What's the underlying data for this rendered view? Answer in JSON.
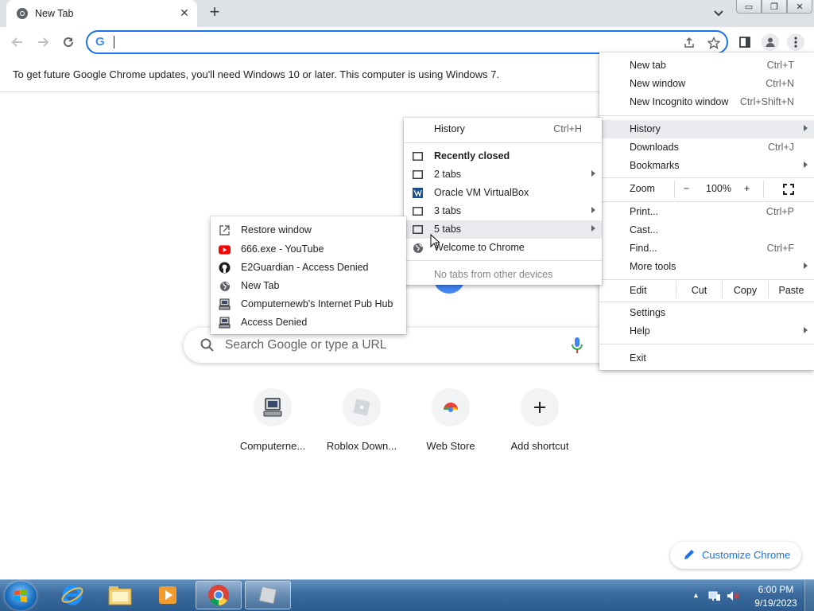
{
  "tab": {
    "title": "New Tab",
    "close": "✕"
  },
  "new_tab_button": "+",
  "window_controls": {
    "minimize": "▭",
    "restore": "❐",
    "close": "✕"
  },
  "toolbar": {
    "omnibox_value": "",
    "omnibox_g": "G"
  },
  "infobar": {
    "message": "To get future Google Chrome updates, you'll need Windows 10 or later. This computer is using Windows 7."
  },
  "ntp": {
    "search_placeholder": "Search Google or type a URL",
    "shortcuts": [
      {
        "label": "Computerne...",
        "icon": "computer-icon"
      },
      {
        "label": "Roblox Down...",
        "icon": "roblox-icon"
      },
      {
        "label": "Web Store",
        "icon": "chrome-webstore-icon"
      },
      {
        "label": "Add shortcut",
        "icon": "plus-icon"
      }
    ],
    "customize_label": "Customize Chrome"
  },
  "main_menu": {
    "new_tab": {
      "label": "New tab",
      "shortcut": "Ctrl+T"
    },
    "new_window": {
      "label": "New window",
      "shortcut": "Ctrl+N"
    },
    "new_incognito": {
      "label": "New Incognito window",
      "shortcut": "Ctrl+Shift+N"
    },
    "history": {
      "label": "History"
    },
    "downloads": {
      "label": "Downloads",
      "shortcut": "Ctrl+J"
    },
    "bookmarks": {
      "label": "Bookmarks"
    },
    "zoom": {
      "label": "Zoom",
      "minus": "−",
      "level": "100%",
      "plus": "+"
    },
    "print": {
      "label": "Print...",
      "shortcut": "Ctrl+P"
    },
    "cast": {
      "label": "Cast..."
    },
    "find": {
      "label": "Find...",
      "shortcut": "Ctrl+F"
    },
    "more_tools": {
      "label": "More tools"
    },
    "edit": {
      "label": "Edit",
      "cut": "Cut",
      "copy": "Copy",
      "paste": "Paste"
    },
    "settings": {
      "label": "Settings"
    },
    "help": {
      "label": "Help"
    },
    "exit": {
      "label": "Exit"
    }
  },
  "history_menu": {
    "history": {
      "label": "History",
      "shortcut": "Ctrl+H"
    },
    "recently_closed": "Recently closed",
    "items": [
      {
        "label": "2 tabs",
        "icon": "tab-window-icon",
        "submenu": true
      },
      {
        "label": "Oracle VM VirtualBox",
        "icon": "virtualbox-icon",
        "submenu": false
      },
      {
        "label": "3 tabs",
        "icon": "tab-window-icon",
        "submenu": true
      },
      {
        "label": "5 tabs",
        "icon": "tab-window-icon",
        "submenu": true
      },
      {
        "label": "Welcome to Chrome",
        "icon": "globe-icon",
        "submenu": false
      }
    ],
    "no_other_devices": "No tabs from other devices"
  },
  "tabs_submenu": {
    "items": [
      {
        "label": "Restore window",
        "icon": "open-external-icon"
      },
      {
        "label": "666.exe - YouTube",
        "icon": "youtube-icon"
      },
      {
        "label": "E2Guardian - Access Denied",
        "icon": "github-icon"
      },
      {
        "label": "New Tab",
        "icon": "globe-icon"
      },
      {
        "label": "Computernewb's Internet Pub Hub",
        "icon": "computer-icon"
      },
      {
        "label": "Access Denied",
        "icon": "computer-icon"
      }
    ]
  },
  "taskbar": {
    "time": "6:00 PM",
    "date": "9/19/2023",
    "apps": [
      "internet-explorer-icon",
      "file-explorer-icon",
      "media-player-icon",
      "chrome-icon",
      "virtualbox-app-icon"
    ]
  },
  "colors": {
    "accent": "#1a73e8",
    "tabstrip": "#dee1e6",
    "menu_highlight": "#e8eaed"
  }
}
